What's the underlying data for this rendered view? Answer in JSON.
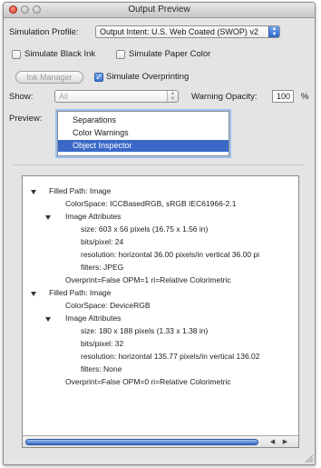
{
  "window": {
    "title": "Output Preview"
  },
  "simulation": {
    "profile_label": "Simulation Profile:",
    "profile_value": "Output Intent: U.S. Web Coated (SWOP) v2",
    "black_ink_label": "Simulate Black Ink",
    "black_ink_checked": false,
    "paper_color_label": "Simulate Paper Color",
    "paper_color_checked": false,
    "ink_manager_label": "Ink Manager",
    "overprinting_label": "Simulate Overprinting",
    "overprinting_checked": true
  },
  "show": {
    "label": "Show:",
    "value": "All",
    "warning_opacity_label": "Warning Opacity:",
    "warning_opacity_value": "100",
    "percent_label": "%"
  },
  "preview": {
    "label": "Preview:",
    "options": [
      "Separations",
      "Color Warnings",
      "Object Inspector"
    ],
    "selected": "Object Inspector"
  },
  "tree": [
    {
      "text": "Filled Path: Image",
      "disclosure": true
    },
    {
      "text": "ColorSpace: ICCBasedRGB, sRGB IEC61966-2.1"
    },
    {
      "text": "Image Attributes",
      "disclosure": true
    },
    {
      "text": "size: 603 x 56 pixels (16.75 x 1.56 in)"
    },
    {
      "text": "bits/pixel: 24"
    },
    {
      "text": "resolution: horizontal 36.00 pixels/in vertical 36.00 pi"
    },
    {
      "text": "filters: JPEG"
    },
    {
      "text": "Overprint=False OPM=1 ri=Relative Colorimetric"
    },
    {
      "text": "Filled Path: Image",
      "disclosure": true
    },
    {
      "text": "ColorSpace: DeviceRGB"
    },
    {
      "text": "Image Attributes",
      "disclosure": true
    },
    {
      "text": "size: 180 x 188 pixels (1.33 x 1.38 in)"
    },
    {
      "text": "bits/pixel: 32"
    },
    {
      "text": "resolution: horizontal 135.77 pixels/in vertical 136.02"
    },
    {
      "text": "filters: None"
    },
    {
      "text": "Overprint=False OPM=0 ri=Relative Colorimetric"
    }
  ],
  "colors": {
    "accent": "#3968c7",
    "selection": "#3968c7",
    "close_button": "#d9362b"
  },
  "icons": {
    "disclosure": "disclosure-triangle-icon",
    "scroll_left": "scroll-left-arrow-icon",
    "scroll_right": "scroll-right-arrow-icon",
    "resize": "resize-grip-icon"
  }
}
